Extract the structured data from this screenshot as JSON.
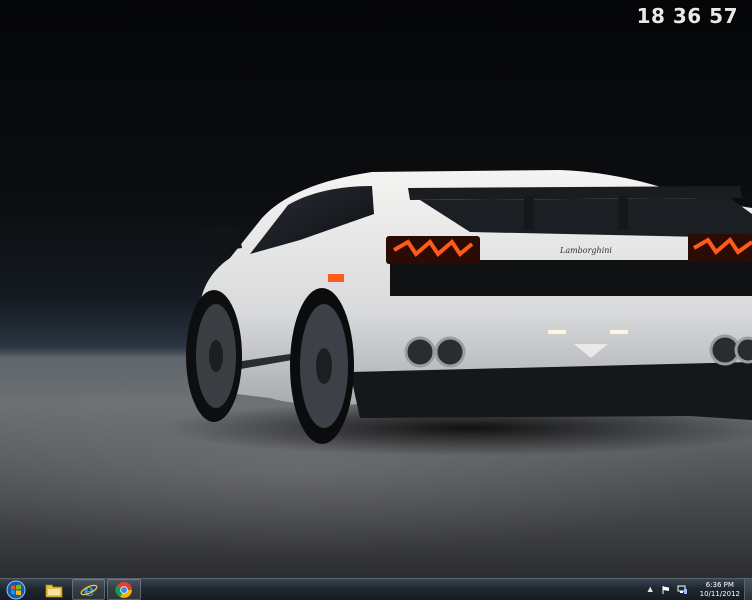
{
  "desktop": {
    "clock_gadget": "18 36 57",
    "wallpaper": {
      "icon": "car-wallpaper",
      "badge_text": "Lamborghini"
    }
  },
  "taskbar": {
    "start_icon": "windows-orb-icon",
    "pinned": [
      {
        "name": "explorer",
        "icon": "folder-icon"
      },
      {
        "name": "internet-explorer",
        "icon": "ie-icon"
      },
      {
        "name": "chrome",
        "icon": "chrome-icon"
      }
    ],
    "tray": {
      "chevron": "▲",
      "time": "6:36 PM",
      "date": "10/11/2012"
    }
  },
  "colors": {
    "taskbar": "#1f2830",
    "taillight": "#ff4a1a",
    "car_body": "#e8e8e6"
  }
}
